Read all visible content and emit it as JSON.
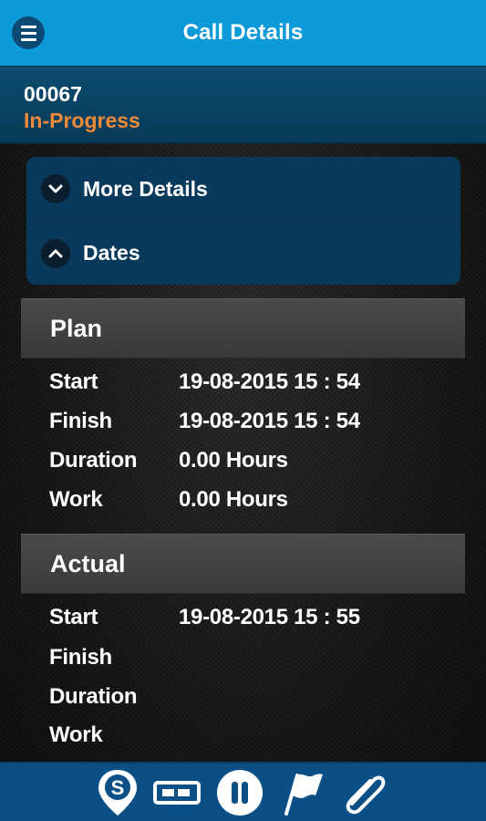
{
  "header": {
    "title": "Call Details",
    "menu_icon": "hamburger-icon"
  },
  "call": {
    "number": "00067",
    "status": "In-Progress",
    "status_color": "#f08a38"
  },
  "accordion": [
    {
      "label": "More Details",
      "icon": "chevron-down-icon",
      "expanded": false
    },
    {
      "label": "Dates",
      "icon": "chevron-up-icon",
      "expanded": true
    }
  ],
  "plan": {
    "heading": "Plan",
    "rows": [
      {
        "label": "Start",
        "value": "19-08-2015 15 : 54"
      },
      {
        "label": "Finish",
        "value": "19-08-2015 15 : 54"
      },
      {
        "label": "Duration",
        "value": "0.00 Hours"
      },
      {
        "label": "Work",
        "value": "0.00 Hours"
      }
    ]
  },
  "actual": {
    "heading": "Actual",
    "rows": [
      {
        "label": "Start",
        "value": "19-08-2015 15 : 55"
      },
      {
        "label": "Finish",
        "value": ""
      },
      {
        "label": "Duration",
        "value": ""
      },
      {
        "label": "Work",
        "value": ""
      }
    ]
  },
  "toolbar": {
    "icons": [
      "location-pin-s-icon",
      "battery-icon",
      "pause-icon",
      "flag-icon",
      "paperclip-icon"
    ],
    "s_letter": "S"
  },
  "colors": {
    "topbar": "#0d9ad8",
    "accent": "#f08a38",
    "bottombar": "#0a4f85"
  }
}
